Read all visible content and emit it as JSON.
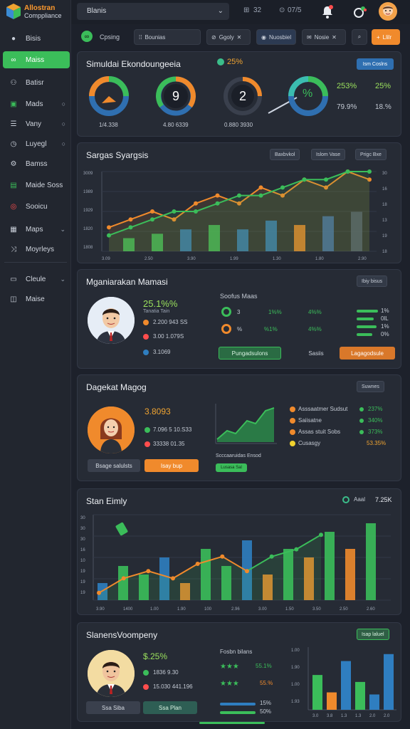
{
  "app": {
    "logo_line1": "Allostran",
    "logo_line2": "Comppliance"
  },
  "sidebar": {
    "items": [
      {
        "label": "Bisis",
        "icon": "circle-icon"
      },
      {
        "label": "Maiss",
        "icon": "link-icon",
        "active": true
      },
      {
        "label": "Batisr",
        "icon": "users-icon"
      },
      {
        "label": "Mads",
        "icon": "document-icon",
        "arrow": "○"
      },
      {
        "label": "Vany",
        "icon": "list-icon",
        "arrow": "○"
      },
      {
        "label": "Luyegl",
        "icon": "clock-icon",
        "arrow": "○"
      },
      {
        "label": "Bamss",
        "icon": "gear-icon"
      },
      {
        "label": "Maide Soss",
        "icon": "file-icon"
      },
      {
        "label": "Sooicu",
        "icon": "target-icon"
      },
      {
        "label": "Maps",
        "icon": "grid-icon",
        "arrow": "⌄"
      },
      {
        "label": "Moyrleys",
        "icon": "shuffle-icon"
      },
      {
        "label": "Cleule",
        "icon": "card-icon",
        "arrow": "⌄"
      },
      {
        "label": "Maise",
        "icon": "window-icon"
      }
    ]
  },
  "topbar": {
    "select_value": "Blanis",
    "item1": "32",
    "item2": "07/5",
    "bell_label": "1",
    "user_initials": ""
  },
  "subbar": {
    "workspace": "Cpsing",
    "search": "Bounias",
    "b1": "Ggoly",
    "b2": "Nuosbiel",
    "b3": "Nosie",
    "b4": "Llilr"
  },
  "panel1": {
    "title": "Simuldai Ekondoungeeia",
    "badge": "25%",
    "button": "Ism Coslns",
    "gauges": [
      {
        "label": "1/4.338",
        "center": ""
      },
      {
        "label": "4.80 6339",
        "center": "9"
      },
      {
        "label": "0.880 3930",
        "center": "2"
      },
      {
        "label": "",
        "center": "%"
      }
    ],
    "stats": [
      {
        "value": "253%",
        "sub": "79.9%"
      },
      {
        "value": "25%",
        "sub": "18.%"
      }
    ]
  },
  "panel2": {
    "title": "Sargas Syargsis",
    "buttons": [
      "Baxbvkol",
      "Islom Vase",
      "Prigc Bxe"
    ],
    "yticks_left": [
      "3009",
      "1989",
      "1929",
      "1820",
      "1808"
    ],
    "yticks_right": [
      "30",
      "16",
      "18",
      "13",
      "19",
      "18"
    ],
    "xticks": [
      "3.09",
      "2.50",
      "3.90",
      "1.99",
      "1.30",
      "1.80",
      "2.90"
    ]
  },
  "panel3": {
    "title": "Mganiarakan Mamasi",
    "button": "Ibiy bisus",
    "value": "25.1%%",
    "sub": "Tanatia Tain",
    "rows": [
      "2.200 943 SS",
      "3.00 1.079S",
      "3.1069"
    ],
    "mid_title": "Soofus Maas",
    "mid_rows": [
      {
        "a": "3",
        "b": "1%%",
        "c": "4%%"
      },
      {
        "a": "%",
        "b": "%1%",
        "c": "4%%"
      }
    ],
    "right_values": [
      "1%",
      "0lL",
      "1%",
      "0%"
    ],
    "btn_green": "Pungadsulons",
    "btn_link": "Sasiis",
    "btn_orange": "Lagagodsule"
  },
  "panel4": {
    "title": "Dagekat Magog",
    "button": "Suwnes",
    "value": "3.8093",
    "rows": [
      "7.096 5 10.S33",
      "33338 01.35"
    ],
    "btn_grey": "Bsage salulsts",
    "btn_orange": "Isay bup",
    "chart_label": "Scccaaruidas Ensod",
    "chart_tag": "Lusasa Sal",
    "list": [
      {
        "label": "Asssaatmer Sudsut",
        "value": "237%"
      },
      {
        "label": "Saiisatne",
        "value": "340%"
      },
      {
        "label": "Assas stuit Sobs",
        "value": "373%"
      },
      {
        "label": "Cusasgy",
        "value": "53.35%"
      }
    ]
  },
  "panel5": {
    "title": "Stan Eimly",
    "badge": "7.25K",
    "badge_prefix": "Aaal",
    "yticks": [
      "30",
      "30",
      "30",
      "16",
      "10",
      "19",
      "19",
      "19"
    ],
    "xticks": [
      "3.90",
      "1400",
      "1.00",
      "1.90",
      "100",
      "2.96",
      "3.00",
      "1.50",
      "3.50",
      "2.50",
      "2.60"
    ]
  },
  "panel6": {
    "title": "SlanensVoompeny",
    "button": "Isap laluel",
    "value": "$.25%",
    "rows": [
      "1836 9.30",
      "15.030 441.196"
    ],
    "btn1": "Ssa Siba",
    "btn2": "Ssa Plan",
    "mid_title": "Fosbn bilans",
    "mid_values": [
      "55.1%",
      "55.%",
      "15%",
      "50%"
    ],
    "yticks": [
      "1.00",
      "1.90",
      "1.00",
      "1.93"
    ],
    "xticks": [
      "3.0",
      "3.8",
      "1.3",
      "1.3",
      "2.0",
      "2.0"
    ]
  },
  "colors": {
    "accent": "#3bbd5a",
    "orange": "#f08a2c",
    "blue": "#2f7ec0",
    "bg": "#1d212b",
    "panel": "#262b35"
  },
  "chart_data": [
    {
      "type": "line",
      "title": "Sargas Syargsis",
      "series": [
        {
          "values": [
            3,
            4,
            5,
            4,
            6,
            7,
            6,
            8,
            7,
            9,
            8,
            10,
            9
          ]
        },
        {
          "values": [
            2,
            3,
            4,
            5,
            5,
            6,
            7,
            7,
            8,
            9,
            9,
            10,
            10
          ]
        }
      ]
    },
    {
      "type": "line",
      "title": "Stan Eimly",
      "series": [
        {
          "values": [
            1,
            3,
            4,
            3,
            5,
            6,
            4,
            6,
            7,
            9
          ]
        }
      ],
      "bars": [
        2,
        4,
        3,
        5,
        2,
        6,
        4,
        7,
        3,
        6,
        5,
        8,
        6,
        9
      ]
    }
  ]
}
